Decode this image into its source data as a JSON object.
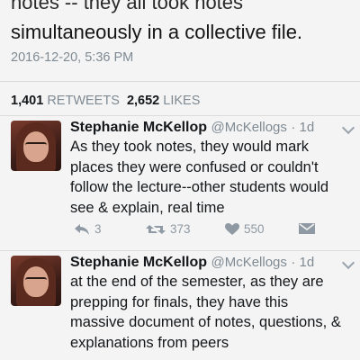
{
  "top_text": {
    "line1": "notes -- they all took notes",
    "line2": "simultaneously in a collective file."
  },
  "timestamp": "2016-12-20, 5:36 PM",
  "stats": {
    "retweets_count": "1,401",
    "retweets_label": "RETWEETS",
    "likes_count": "2,652",
    "likes_label": "LIKES"
  },
  "replies": [
    {
      "name": "Stephanie McKellop",
      "handle": "@McKellogs",
      "time": "· 1d",
      "lines": [
        "As they took notes, they would mark",
        "places they were confused or couldn't",
        "follow the lecture--other students would",
        "see & explain, real time"
      ],
      "reply_count": "3",
      "retweet_count": "373",
      "like_count": "550"
    },
    {
      "name": "Stephanie McKellop",
      "handle": "@McKellogs",
      "time": "· 1d",
      "lines": [
        "at the end of the semester, as they are",
        "prepping for finals, they have this",
        "massive document of notes, questions, &",
        "explanations from peers"
      ]
    }
  ],
  "icons": {
    "reply": "reply-icon",
    "retweet": "retweet-icon",
    "like": "heart-icon",
    "dm": "envelope-icon",
    "more": "chevron-down-icon"
  },
  "colors": {
    "background": "#f4f4f4",
    "text": "#14171a",
    "muted": "#7f8a93",
    "action": "#8e99a3"
  }
}
